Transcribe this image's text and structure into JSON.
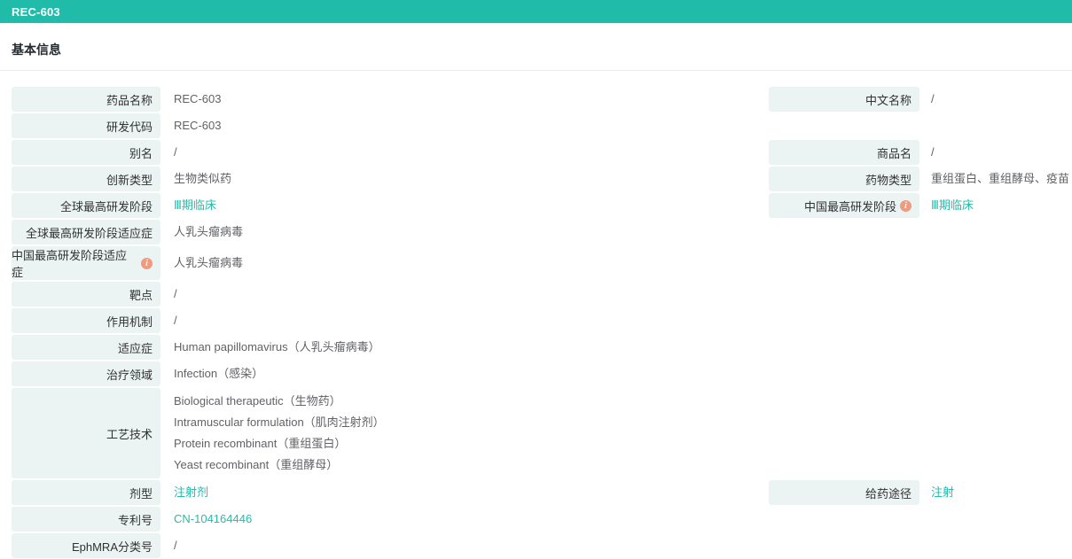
{
  "header": {
    "title": "REC-603"
  },
  "section": {
    "title": "基本信息"
  },
  "colors": {
    "accent": "#21bca9",
    "link": "#2bb9a8",
    "label_bg": "#ecf4f3",
    "info_icon": "#ee9b7f"
  },
  "table": {
    "rows": [
      {
        "left": {
          "label": "药品名称",
          "info": false,
          "values": [
            {
              "text": "REC-603",
              "link": false
            }
          ]
        },
        "right": {
          "label": "中文名称",
          "info": false,
          "values": [
            {
              "text": "/",
              "link": false
            }
          ]
        }
      },
      {
        "left": {
          "label": "研发代码",
          "info": false,
          "values": [
            {
              "text": "REC-603",
              "link": false
            }
          ]
        },
        "right": null
      },
      {
        "left": {
          "label": "别名",
          "info": false,
          "values": [
            {
              "text": "/",
              "link": false
            }
          ]
        },
        "right": {
          "label": "商品名",
          "info": false,
          "values": [
            {
              "text": "/",
              "link": false
            }
          ]
        }
      },
      {
        "left": {
          "label": "创新类型",
          "info": false,
          "values": [
            {
              "text": "生物类似药",
              "link": false
            }
          ]
        },
        "right": {
          "label": "药物类型",
          "info": false,
          "values": [
            {
              "text": "重组蛋白、重组酵母、疫苗",
              "link": false
            }
          ]
        }
      },
      {
        "left": {
          "label": "全球最高研发阶段",
          "info": false,
          "values": [
            {
              "text": "Ⅲ期临床",
              "link": true
            }
          ]
        },
        "right": {
          "label": "中国最高研发阶段",
          "info": true,
          "values": [
            {
              "text": "Ⅲ期临床",
              "link": true
            }
          ]
        }
      },
      {
        "left": {
          "label": "全球最高研发阶段适应症",
          "info": false,
          "values": [
            {
              "text": "人乳头瘤病毒",
              "link": false
            }
          ]
        },
        "right": null
      },
      {
        "left": {
          "label": "中国最高研发阶段适应症",
          "info": true,
          "values": [
            {
              "text": "人乳头瘤病毒",
              "link": false
            }
          ]
        },
        "right": null
      },
      {
        "left": {
          "label": "靶点",
          "info": false,
          "values": [
            {
              "text": "/",
              "link": false
            }
          ]
        },
        "right": null
      },
      {
        "left": {
          "label": "作用机制",
          "info": false,
          "values": [
            {
              "text": "/",
              "link": false
            }
          ]
        },
        "right": null
      },
      {
        "left": {
          "label": "适应症",
          "info": false,
          "values": [
            {
              "text": "Human papillomavirus（人乳头瘤病毒）",
              "link": false
            }
          ]
        },
        "right": null
      },
      {
        "left": {
          "label": "治疗领域",
          "info": false,
          "values": [
            {
              "text": "Infection（感染）",
              "link": false
            }
          ]
        },
        "right": null
      },
      {
        "left": {
          "label": "工艺技术",
          "info": false,
          "values": [
            {
              "text": "Biological therapeutic（生物药）",
              "link": false
            },
            {
              "text": "Intramuscular formulation（肌肉注射剂）",
              "link": false
            },
            {
              "text": "Protein recombinant（重组蛋白）",
              "link": false
            },
            {
              "text": "Yeast recombinant（重组酵母）",
              "link": false
            }
          ]
        },
        "right": null
      },
      {
        "left": {
          "label": "剂型",
          "info": false,
          "values": [
            {
              "text": "注射剂",
              "link": true
            }
          ]
        },
        "right": {
          "label": "给药途径",
          "info": false,
          "values": [
            {
              "text": "注射",
              "link": true
            }
          ]
        }
      },
      {
        "left": {
          "label": "专利号",
          "info": false,
          "values": [
            {
              "text": "CN-104164446",
              "link": true
            }
          ]
        },
        "right": null
      },
      {
        "left": {
          "label": "EphMRA分类号",
          "info": false,
          "values": [
            {
              "text": "/",
              "link": false
            }
          ]
        },
        "right": null
      }
    ]
  }
}
